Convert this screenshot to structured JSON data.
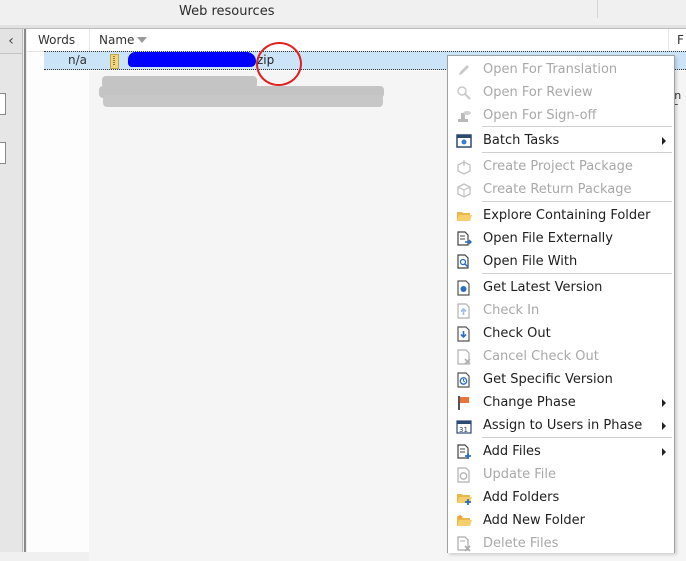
{
  "topbar": {
    "title": "Web resources"
  },
  "leftpanel": {
    "collapse_icon": "chevron-left-icon",
    "collapse_glyph": "‹"
  },
  "filelist": {
    "columns": [
      "Words",
      "Name",
      "F"
    ],
    "sort_indicator": "sort-descending-icon",
    "selected_row": {
      "words": "n/a",
      "name_visible_suffix": "zip",
      "icon": "zip-archive-icon"
    },
    "partial_text_right": "In T"
  },
  "context_menu": {
    "items": [
      {
        "label": "Open For Translation",
        "icon": "pencil-icon",
        "enabled": false,
        "submenu": false
      },
      {
        "label": "Open For Review",
        "icon": "magnifier-icon",
        "enabled": false,
        "submenu": false
      },
      {
        "label": "Open For Sign-off",
        "icon": "stamp-icon",
        "enabled": false,
        "submenu": false
      },
      {
        "label": "Batch Tasks",
        "icon": "batch-gear-icon",
        "enabled": true,
        "submenu": true
      },
      {
        "label": "Create Project Package",
        "icon": "package-icon",
        "enabled": false,
        "submenu": false
      },
      {
        "label": "Create Return Package",
        "icon": "return-package-icon",
        "enabled": false,
        "submenu": false
      },
      {
        "label": "Explore Containing Folder",
        "icon": "folder-open-icon",
        "enabled": true,
        "submenu": false
      },
      {
        "label": "Open File Externally",
        "icon": "file-external-icon",
        "enabled": true,
        "submenu": false
      },
      {
        "label": "Open File With",
        "icon": "file-search-icon",
        "enabled": true,
        "submenu": false
      },
      {
        "label": "Get Latest Version",
        "icon": "get-latest-icon",
        "enabled": true,
        "submenu": false
      },
      {
        "label": "Check In",
        "icon": "check-in-icon",
        "enabled": false,
        "submenu": false
      },
      {
        "label": "Check Out",
        "icon": "check-out-icon",
        "enabled": true,
        "submenu": false
      },
      {
        "label": "Cancel Check Out",
        "icon": "cancel-check-out-icon",
        "enabled": false,
        "submenu": false
      },
      {
        "label": "Get Specific Version",
        "icon": "specific-version-icon",
        "enabled": true,
        "submenu": false
      },
      {
        "label": "Change Phase",
        "icon": "flag-icon",
        "enabled": true,
        "submenu": true
      },
      {
        "label": "Assign to Users in Phase",
        "icon": "calendar-icon",
        "enabled": true,
        "submenu": true
      },
      {
        "label": "Add Files",
        "icon": "add-file-icon",
        "enabled": true,
        "submenu": true
      },
      {
        "label": "Update File",
        "icon": "update-file-icon",
        "enabled": false,
        "submenu": false
      },
      {
        "label": "Add Folders",
        "icon": "add-folder-icon",
        "enabled": true,
        "submenu": false
      },
      {
        "label": "Add New Folder",
        "icon": "new-folder-icon",
        "enabled": true,
        "submenu": false
      },
      {
        "label": "Delete Files",
        "icon": "delete-file-icon",
        "enabled": false,
        "submenu": false
      }
    ]
  }
}
